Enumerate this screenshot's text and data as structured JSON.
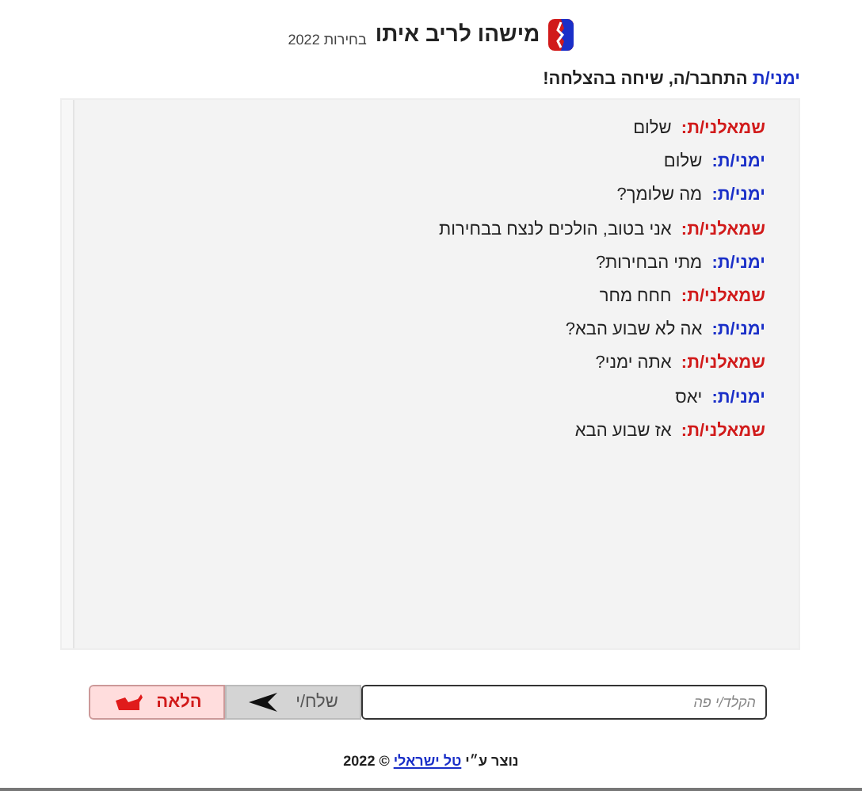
{
  "header": {
    "title": "מישהו לריב איתו",
    "subtitle": "בחירות 2022"
  },
  "status": {
    "speaker": "ימני/ת",
    "kind": "right",
    "text": "התחבר/ה, שיחה בהצלחה!"
  },
  "messages": [
    {
      "speaker": "שמאלני/ת:",
      "kind": "left",
      "text": "שלום"
    },
    {
      "speaker": "ימני/ת:",
      "kind": "right",
      "text": "שלום"
    },
    {
      "speaker": "ימני/ת:",
      "kind": "right",
      "text": "מה שלומך?"
    },
    {
      "speaker": "שמאלני/ת:",
      "kind": "left",
      "text": "אני בטוב, הולכים לנצח בבחירות"
    },
    {
      "speaker": "ימני/ת:",
      "kind": "right",
      "text": "מתי הבחירות?"
    },
    {
      "speaker": "שמאלני/ת:",
      "kind": "left",
      "text": "חחח מחר"
    },
    {
      "speaker": "ימני/ת:",
      "kind": "right",
      "text": "אה לא שבוע הבא?"
    },
    {
      "speaker": "שמאלני/ת:",
      "kind": "left",
      "text": "אתה ימני?"
    },
    {
      "speaker": "ימני/ת:",
      "kind": "right",
      "text": "יאס"
    },
    {
      "speaker": "שמאלני/ת:",
      "kind": "left",
      "text": "אז שבוע הבא"
    }
  ],
  "input": {
    "placeholder": "הקלד/י פה"
  },
  "send_button": "שלח/י",
  "next_button": "הלאה",
  "footer": {
    "prefix": "נוצר ע״י",
    "link": "טל ישראלי",
    "suffix": "© 2022"
  }
}
